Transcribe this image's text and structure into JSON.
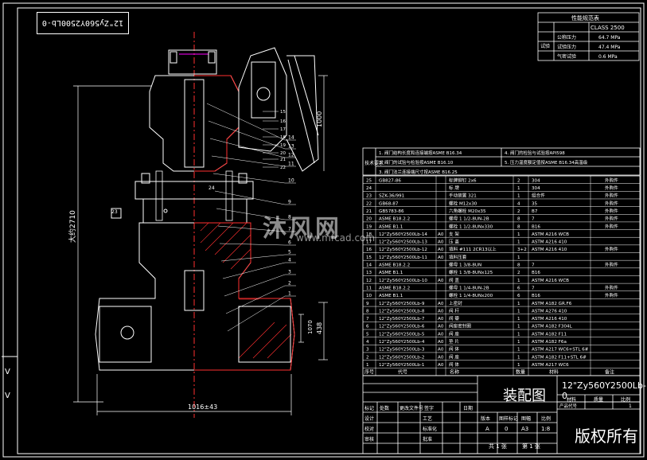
{
  "drawing": {
    "flipped_label": "12\"Zy560Y2500Lb-0",
    "watermark_text": "沐风网",
    "watermark_url": "www.mfcad.com",
    "assembly_title": "装配图",
    "drawing_number": "12\"Zy560Y2500Lb-0",
    "copyright": "版权所有",
    "dim_width": "1016±43",
    "dim_height": "大约2710",
    "dim_total": "1000",
    "dim_right": "438",
    "dim_side": "1070"
  },
  "spec_table": {
    "header": "性能规范表",
    "class": "CLASS 2500",
    "rows": [
      {
        "label": "公称压力",
        "value": "64.7 MPa"
      },
      {
        "label": "试验压力",
        "value": "47.4 MPa"
      },
      {
        "label": "气密试验",
        "value": "0.6 MPa"
      }
    ],
    "side_label": "试验"
  },
  "tech_requirements": {
    "label": "技术要求",
    "items": [
      "1. 阀门结构长度和连接端按ASME B16.34",
      "2. 阀门的试验与检验按ASME B16.10",
      "3. 阀门法兰连接端尺寸按ASME B16.25",
      "4. 阀门的检验与试验按API598",
      "5. 压力温度额定值按ASME B16.34高温级"
    ]
  },
  "bom": {
    "headers": [
      "序号",
      "代号",
      "名称",
      "数量",
      "材料",
      "备注"
    ],
    "rows": [
      {
        "no": "25",
        "code": "GB827-86",
        "grade": "",
        "name": "标牌铆钉 2x6",
        "qty": "2",
        "mat": "304",
        "note": "外购件"
      },
      {
        "no": "24",
        "code": "",
        "grade": "",
        "name": "标 牌",
        "qty": "1",
        "mat": "304",
        "note": "外购件"
      },
      {
        "no": "23",
        "code": "SZK-36/991",
        "grade": "",
        "name": "手动装置 321",
        "qty": "1",
        "mat": "组合件",
        "note": "外购件"
      },
      {
        "no": "22",
        "code": "GB68-87",
        "grade": "",
        "name": "螺栓 M12x30",
        "qty": "4",
        "mat": "35",
        "note": "外购件"
      },
      {
        "no": "21",
        "code": "GB5783-86",
        "grade": "",
        "name": "六角螺栓 M20x35",
        "qty": "2",
        "mat": "B7",
        "note": "外购件"
      },
      {
        "no": "20",
        "code": "ASME B18.2.2",
        "grade": "",
        "name": "螺母 1 1/2-8UN-2B",
        "qty": "8",
        "mat": "7",
        "note": "外购件"
      },
      {
        "no": "19",
        "code": "ASME B1.1",
        "grade": "",
        "name": "螺栓 1 1/2-8UNx330",
        "qty": "8",
        "mat": "B16",
        "note": "外购件"
      },
      {
        "no": "18",
        "code": "12\"Zy560Y2500Lb-14",
        "grade": "A0",
        "name": "支 架",
        "qty": "1",
        "mat": "ASTM A216 WCB",
        "note": ""
      },
      {
        "no": "17",
        "code": "12\"Zy560Y2500Lb-13",
        "grade": "A0",
        "name": "压 盖",
        "qty": "1",
        "mat": "ASTM A216 410",
        "note": ""
      },
      {
        "no": "16",
        "code": "12\"Zy560Y2500Lb-12",
        "grade": "A0",
        "name": "填料 #111 2CR13以上",
        "qty": "3+2",
        "mat": "ASTM A216 410",
        "note": "外购件"
      },
      {
        "no": "15",
        "code": "12\"Zy560Y2500Lb-11",
        "grade": "A0",
        "name": "填料压套",
        "qty": "1",
        "mat": "",
        "note": ""
      },
      {
        "no": "14",
        "code": "ASME B18.2.2",
        "grade": "",
        "name": "螺母 1 3/8-8UN",
        "qty": "8",
        "mat": "7",
        "note": "外购件"
      },
      {
        "no": "13",
        "code": "ASME B1.1",
        "grade": "",
        "name": "螺栓 1 3/8-8UNx125",
        "qty": "2",
        "mat": "B16",
        "note": ""
      },
      {
        "no": "12",
        "code": "12\"Zy560Y2500Lb-10",
        "grade": "A0",
        "name": "阀 盖",
        "qty": "1",
        "mat": "ASTM A216 WCB",
        "note": ""
      },
      {
        "no": "11",
        "code": "ASME B18.2.2",
        "grade": "",
        "name": "螺母 1 1/4-8UN-2B",
        "qty": "6",
        "mat": "7",
        "note": "外购件"
      },
      {
        "no": "10",
        "code": "ASME B1.1",
        "grade": "",
        "name": "螺栓 1 1/4-8UNx200",
        "qty": "6",
        "mat": "B16",
        "note": "外购件"
      },
      {
        "no": "9",
        "code": "12\"Zy560Y2500Lb-9",
        "grade": "A0",
        "name": "上密封",
        "qty": "1",
        "mat": "ASTM A182 GR.F6",
        "note": ""
      },
      {
        "no": "8",
        "code": "12\"Zy560Y2500Lb-8",
        "grade": "A0",
        "name": "阀 杆",
        "qty": "1",
        "mat": "ASTM A276 410",
        "note": ""
      },
      {
        "no": "7",
        "code": "12\"Zy560Y2500Lb-7",
        "grade": "A0",
        "name": "阀 瓣",
        "qty": "1",
        "mat": "ASTM A216 410",
        "note": ""
      },
      {
        "no": "6",
        "code": "12\"Zy560Y2500Lb-6",
        "grade": "A0",
        "name": "阀座密封圈",
        "qty": "1",
        "mat": "ASTM A182 F304L",
        "note": ""
      },
      {
        "no": "5",
        "code": "12\"Zy560Y2500Lb-5",
        "grade": "A0",
        "name": "阀 座",
        "qty": "1",
        "mat": "ASTM A182 F11",
        "note": ""
      },
      {
        "no": "4",
        "code": "12\"Zy560Y2500Lb-4",
        "grade": "A0",
        "name": "垫 片",
        "qty": "1",
        "mat": "ASTM A182 F6a",
        "note": ""
      },
      {
        "no": "3",
        "code": "12\"Zy560Y2500Lb-3",
        "grade": "A0",
        "name": "阀 体",
        "qty": "1",
        "mat": "ASTM A217 WC6+STL 6#",
        "note": ""
      },
      {
        "no": "2",
        "code": "12\"Zy560Y2500Lb-2",
        "grade": "A0",
        "name": "阀 座",
        "qty": "1",
        "mat": "ASTM A182 F11+STL 6#",
        "note": ""
      },
      {
        "no": "1",
        "code": "12\"Zy560Y2500Lb-1",
        "grade": "A0",
        "name": "阀 体",
        "qty": "1",
        "mat": "ASTM A217 WC6",
        "note": ""
      }
    ]
  },
  "title_block": {
    "col_labels": [
      "材料",
      "质量",
      "比例"
    ],
    "mark_labels": [
      "标记",
      "处数",
      "更改文件号",
      "签字",
      "日期"
    ],
    "roles": [
      "设计",
      "校对",
      "审核"
    ],
    "roles2": [
      "工艺",
      "标准化",
      "批准"
    ],
    "row2": [
      "版本",
      "图样标记",
      "图幅",
      "比例"
    ],
    "values": [
      "A",
      "0",
      "A3",
      "1:8"
    ],
    "sheet": "共 1 张",
    "sheet2": "第 1 张",
    "unit": "1",
    "scale_label": "产品代号",
    "date": "日期"
  },
  "callouts": [
    "14",
    "13",
    "12",
    "11",
    "10",
    "9",
    "8",
    "7",
    "6",
    "5",
    "4",
    "3",
    "2",
    "1",
    "23",
    "24",
    "15",
    "16",
    "17",
    "18",
    "19",
    "20",
    "21",
    "22"
  ]
}
